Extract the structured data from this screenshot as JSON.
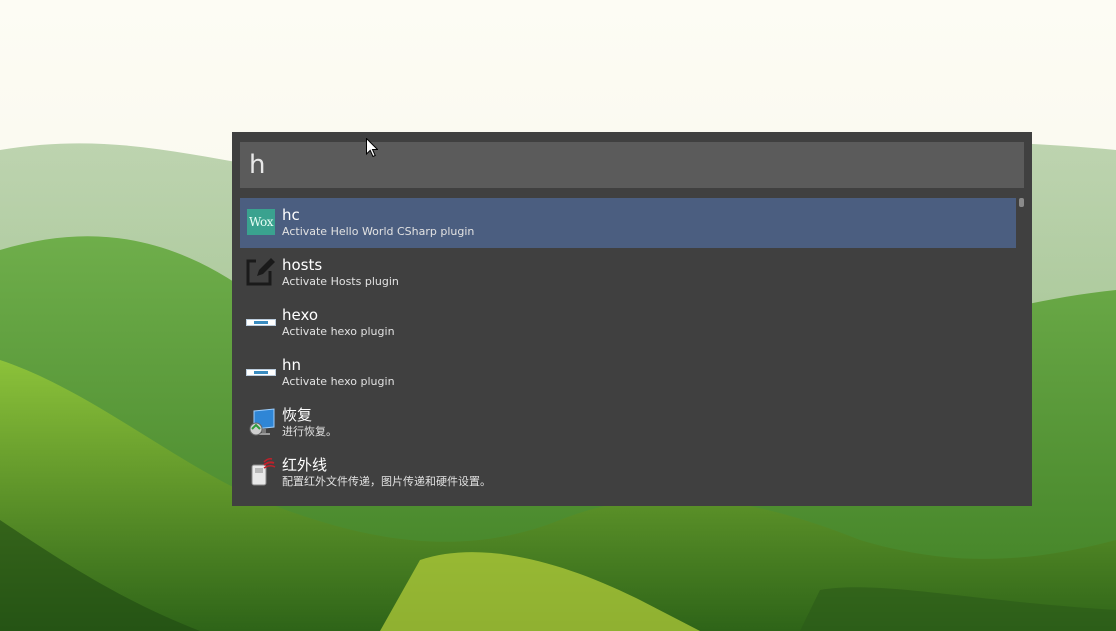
{
  "launcher": {
    "query": "h",
    "results": [
      {
        "title": "hc",
        "subtitle": "Activate Hello World CSharp plugin",
        "icon": "wox-logo-icon",
        "icon_text": "Wox",
        "selected": true
      },
      {
        "title": "hosts",
        "subtitle": "Activate Hosts plugin",
        "icon": "edit-icon",
        "selected": false
      },
      {
        "title": "hexo",
        "subtitle": "Activate hexo plugin",
        "icon": "hexo-logo-icon",
        "selected": false
      },
      {
        "title": "hn",
        "subtitle": "Activate hexo plugin",
        "icon": "hexo-logo-icon",
        "selected": false
      },
      {
        "title": "恢复",
        "subtitle": "进行恢复。",
        "icon": "recovery-icon",
        "selected": false
      },
      {
        "title": "红外线",
        "subtitle": "配置红外文件传递，图片传递和硬件设置。",
        "icon": "infrared-icon",
        "selected": false
      }
    ]
  },
  "colors": {
    "panel": "#404040",
    "query_box": "#5b5b5b",
    "selected_row": "#4b5e80"
  }
}
